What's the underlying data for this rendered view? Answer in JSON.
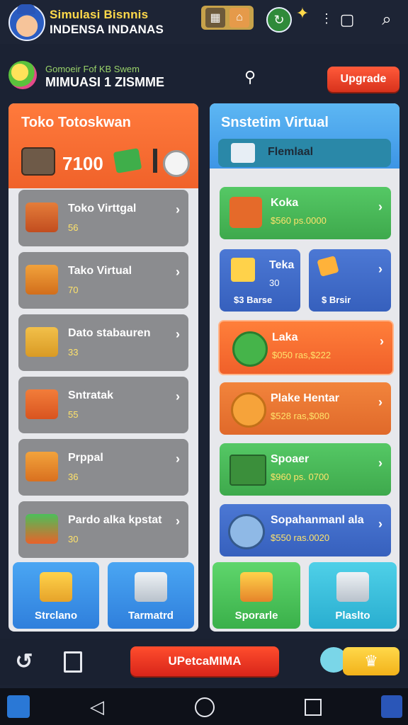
{
  "header": {
    "title_line1": "Simulasi Bisnnis",
    "title_line2": "INDENSA INDANAS",
    "sub_line1": "Gomoeir Fof KB Swem",
    "sub_line2": "MIMUASI 1 ZISMME",
    "upgrade_label": "Upgrade"
  },
  "left_panel": {
    "title": "Toko Totoskwan",
    "balance": "7100",
    "items": [
      {
        "title": "Toko Virttgal",
        "sub": "56"
      },
      {
        "title": "Tako Virtual",
        "sub": "70"
      },
      {
        "title": "Dato stabauren",
        "sub": "33"
      },
      {
        "title": "Sntratak",
        "sub": "55"
      },
      {
        "title": "Prppal",
        "sub": "36"
      },
      {
        "title": "Pardo alka kpstat",
        "sub": "30"
      }
    ],
    "tiles": [
      {
        "label": "Strclano"
      },
      {
        "label": "Tarmatrd"
      }
    ]
  },
  "right_panel": {
    "title": "Snstetim Virtual",
    "search_label": "Flemlaal",
    "cards": [
      {
        "title": "Koka",
        "sub": "$560 ps.0000"
      },
      {
        "title": "Teka",
        "sub": "30",
        "footer": "$3 Barse"
      },
      {
        "title": "",
        "sub": "",
        "footer": "$ Brsir"
      },
      {
        "title": "Laka",
        "sub": "$050 ras,$222"
      },
      {
        "title": "Plake Hentar",
        "sub": "$528 ras,$080"
      },
      {
        "title": "Spoaer",
        "sub": "$960 ps. 0700"
      },
      {
        "title": "Sopahanmanl ala",
        "sub": "$550 ras.0020"
      }
    ],
    "tiles": [
      {
        "label": "Sporarle"
      },
      {
        "label": "Plaslto"
      }
    ]
  },
  "bottom_bar": {
    "cta_label": "UPetcaMIMA"
  },
  "colors": {
    "accent_orange": "#f0622a",
    "accent_blue": "#3d95e6",
    "cta_red": "#d8251a",
    "green_card": "#4cbf5a",
    "blue_card": "#3f67c7",
    "orange_card": "#f07b3a"
  },
  "icons": [
    "avatar-icon",
    "calendar-icon",
    "sync-icon",
    "gift-icon",
    "chat-search-icon",
    "search-icon",
    "key-icon",
    "basket-icon",
    "cash-icon",
    "clock-icon",
    "cart-icon",
    "chevron-right-icon",
    "back-icon",
    "home-icon",
    "recents-icon",
    "share-icon"
  ]
}
